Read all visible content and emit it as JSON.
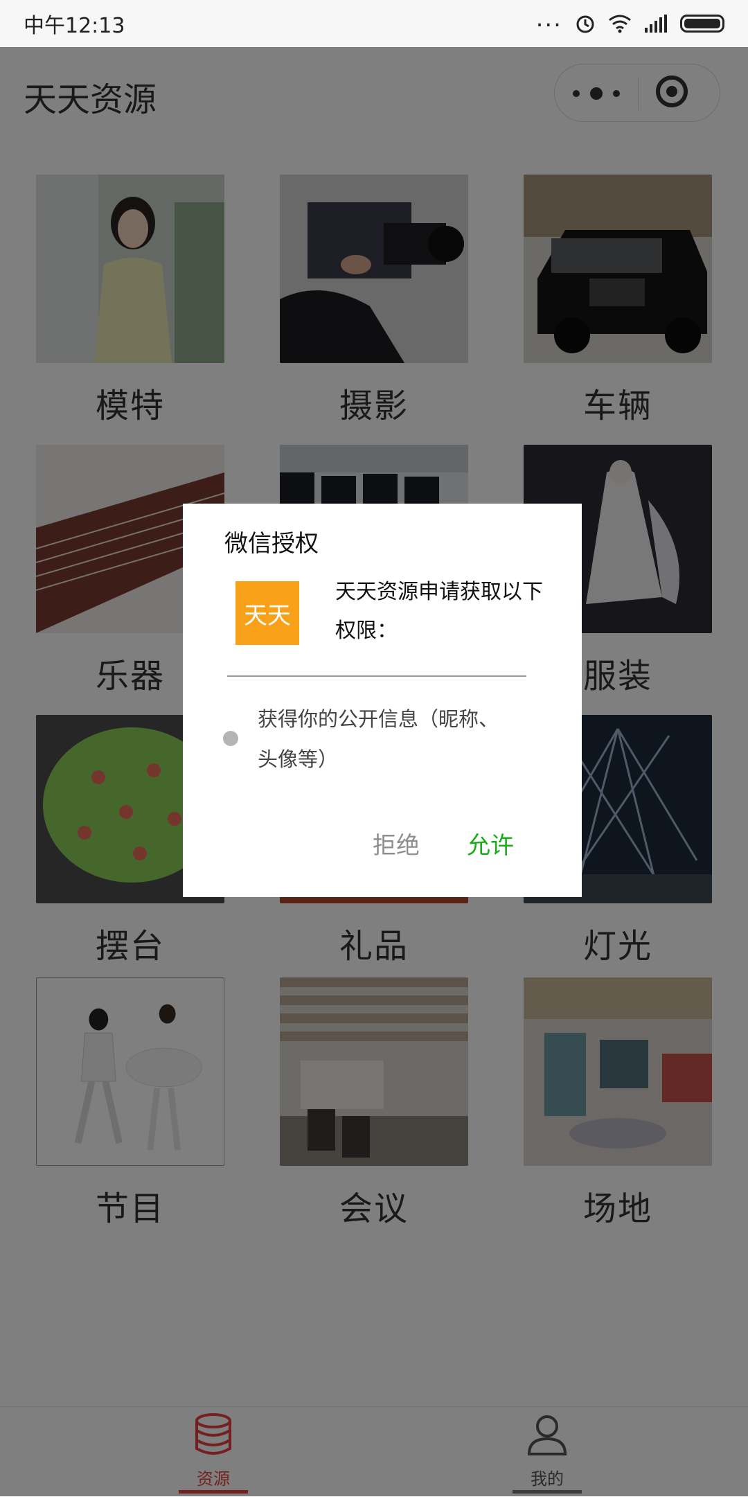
{
  "status_bar": {
    "time": "中午12:13",
    "dots": "..."
  },
  "header": {
    "title": "天天资源"
  },
  "grid": {
    "items": [
      {
        "label": "模特"
      },
      {
        "label": "摄影"
      },
      {
        "label": "车辆"
      },
      {
        "label": "乐器"
      },
      {
        "label": ""
      },
      {
        "label": "服装"
      },
      {
        "label": "摆台"
      },
      {
        "label": "礼品"
      },
      {
        "label": "灯光"
      },
      {
        "label": "节目"
      },
      {
        "label": "会议"
      },
      {
        "label": "场地"
      }
    ]
  },
  "tabbar": {
    "resources_label": "资源",
    "mine_label": "我的",
    "active_color": "#e64340"
  },
  "dialog": {
    "title": "微信授权",
    "app_logo_text": "天天",
    "request_text": "天天资源申请获取以下权限：",
    "scope_text": "获得你的公开信息（昵称、头像等）",
    "deny_label": "拒绝",
    "allow_label": "允许",
    "allow_color": "#1aad19"
  }
}
